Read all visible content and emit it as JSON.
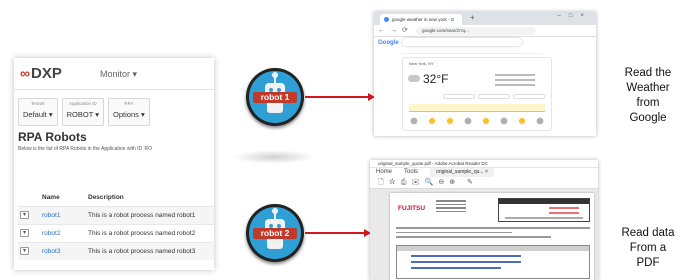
{
  "dxp": {
    "logo": "DXP",
    "monitor_label": "Monitor ▾",
    "filters": [
      {
        "label": "Tenant",
        "value": "Default ▾"
      },
      {
        "label": "Application ID",
        "value": "ROBOT ▾"
      },
      {
        "label": "RPA",
        "value": "Options ▾"
      }
    ],
    "title": "RPA Robots",
    "description": "Below is the list of RPA Robots in the Application with ID 'RO",
    "table": {
      "headers": [
        "",
        "Name",
        "Description"
      ],
      "rows": [
        {
          "name": "robot1",
          "description": "This is a robot process named robot1"
        },
        {
          "name": "robot2",
          "description": "This is a robot process named robot2"
        },
        {
          "name": "robot3",
          "description": "This is a robot process named robot3"
        }
      ]
    }
  },
  "robots": [
    {
      "label": "robot 1"
    },
    {
      "label": "robot 2"
    }
  ],
  "browser": {
    "tab_title": "google weather in new york - G",
    "url": "google.com/search?q...",
    "search_brand": "Google",
    "location": "New York, NY",
    "temperature": "32°F"
  },
  "pdf": {
    "window_title": "original_sample_quote.pdf - Adobe Acrobat Reader DC",
    "menu": [
      "Home",
      "Tools"
    ],
    "doc_tab": "original_sample_qu... ×",
    "company": "FUJITSU"
  },
  "captions": {
    "weather": [
      "Read the",
      "Weather",
      "from",
      "Google"
    ],
    "pdf": [
      "Read data",
      "From a",
      "PDF"
    ]
  },
  "colors": {
    "accent_red": "#d0191f",
    "robot_blue": "#2ea0d6",
    "link_blue": "#2a6ebb"
  }
}
